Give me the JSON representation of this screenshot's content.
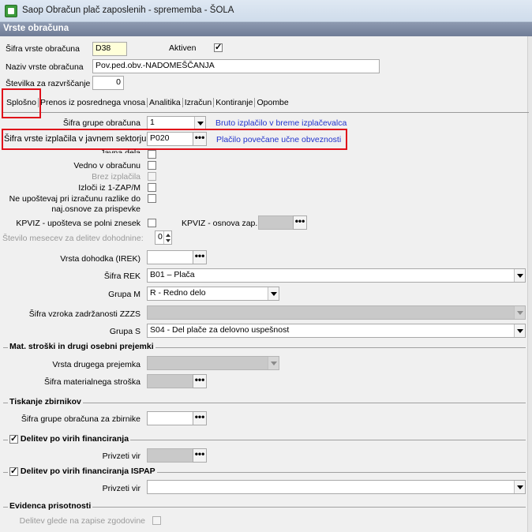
{
  "window": {
    "title": "Saop Obračun plač zaposlenih - sprememba - ŠOLA"
  },
  "header": {
    "title": "Vrste obračuna"
  },
  "form": {
    "sifra_label": "Šifra vrste obračuna",
    "sifra_value": "D38",
    "aktiven_label": "Aktiven",
    "aktiven_checked": "✓",
    "naziv_label": "Naziv vrste obračuna",
    "naziv_value": "Pov.ped.obv.-NADOMEŠČANJA",
    "stevilka_label": "Številka za razvrščanje",
    "stevilka_value": "0"
  },
  "tabs": [
    "Splošno",
    "Prenos iz posrednega vnosa",
    "Analitika",
    "Izračun",
    "Kontiranje",
    "Opombe"
  ],
  "splosno": {
    "sifra_grupe_label": "Šifra grupe obračuna",
    "sifra_grupe_value": "1",
    "sifra_grupe_link": "Bruto izplačilo v breme izplačevalca",
    "sifra_javni_label": "Šifra vrste izplačila v javnem sektorju",
    "sifra_javni_value": "P020",
    "sifra_javni_link": "Plačilo povečane učne obveznosti",
    "partial_label": "Javna dela",
    "vedno_label": "Vedno v obračunu",
    "brez_label": "Brez izplačila",
    "izloci_label": "Izloči iz 1-ZAP/M",
    "neupostevaj_label_1": "Ne upoštevaj pri izračunu razlike do",
    "neupostevaj_label_2": "naj.osnove za prispevke",
    "kpviz_label": "KPVIZ - upošteva se polni znesek",
    "kpviz_osnova_label": "KPVIZ - osnova zap.",
    "stevilo_mesecev_label": "Število mesecev za delitev dohodnine:",
    "stevilo_mesecev_value": "0",
    "vrsta_dohodka_label": "Vrsta dohodka (IREK)",
    "vrsta_dohodka_value": "",
    "sifra_rek_label": "Šifra REK",
    "sifra_rek_value": "B01 – Plača",
    "grupa_m_label": "Grupa M",
    "grupa_m_value": "R - Redno delo",
    "zzzs_label": "Šifra vzroka zadržanosti ZZZS",
    "zzzs_value": "",
    "grupa_s_label": "Grupa S",
    "grupa_s_value": "S04 - Del plače za delovno uspešnost"
  },
  "mat_stroski": {
    "title": "Mat. stroški in drugi osebni prejemki",
    "vrsta_label": "Vrsta drugega prejemka",
    "vrsta_value": "",
    "sifra_label": "Šifra materialnega stroška",
    "sifra_value": ""
  },
  "tiskanje": {
    "title": "Tiskanje zbirnikov",
    "label": "Šifra grupe obračuna za zbirnike",
    "value": ""
  },
  "delitev": {
    "title": "Delitev po virih financiranja",
    "checked": "✓",
    "label": "Privzeti vir",
    "value": ""
  },
  "delitev_ispap": {
    "title": "Delitev po virih financiranja ISPAP",
    "checked": "✓",
    "label": "Privzeti vir",
    "value": ""
  },
  "evidenca": {
    "title": "Evidenca prisotnosti",
    "label": "Delitev glede na zapise zgodovine"
  },
  "ellipsis": "•••",
  "colors": {
    "highlight_box": "#e0101a",
    "link": "#2233cc",
    "header_band": "#7a87a0"
  }
}
